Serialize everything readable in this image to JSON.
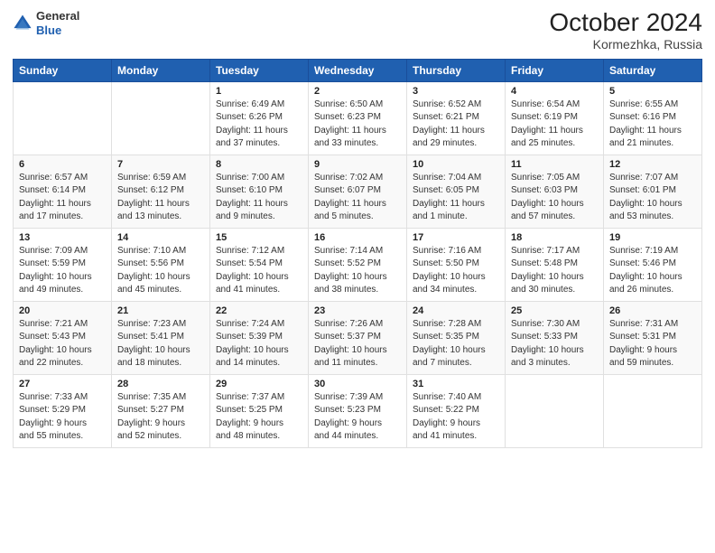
{
  "header": {
    "logo": {
      "general": "General",
      "blue": "Blue"
    },
    "title": "October 2024",
    "location": "Kormezhka, Russia"
  },
  "weekdays": [
    "Sunday",
    "Monday",
    "Tuesday",
    "Wednesday",
    "Thursday",
    "Friday",
    "Saturday"
  ],
  "weeks": [
    [
      {
        "day": "",
        "info": ""
      },
      {
        "day": "",
        "info": ""
      },
      {
        "day": "1",
        "info": "Sunrise: 6:49 AM\nSunset: 6:26 PM\nDaylight: 11 hours\nand 37 minutes."
      },
      {
        "day": "2",
        "info": "Sunrise: 6:50 AM\nSunset: 6:23 PM\nDaylight: 11 hours\nand 33 minutes."
      },
      {
        "day": "3",
        "info": "Sunrise: 6:52 AM\nSunset: 6:21 PM\nDaylight: 11 hours\nand 29 minutes."
      },
      {
        "day": "4",
        "info": "Sunrise: 6:54 AM\nSunset: 6:19 PM\nDaylight: 11 hours\nand 25 minutes."
      },
      {
        "day": "5",
        "info": "Sunrise: 6:55 AM\nSunset: 6:16 PM\nDaylight: 11 hours\nand 21 minutes."
      }
    ],
    [
      {
        "day": "6",
        "info": "Sunrise: 6:57 AM\nSunset: 6:14 PM\nDaylight: 11 hours\nand 17 minutes."
      },
      {
        "day": "7",
        "info": "Sunrise: 6:59 AM\nSunset: 6:12 PM\nDaylight: 11 hours\nand 13 minutes."
      },
      {
        "day": "8",
        "info": "Sunrise: 7:00 AM\nSunset: 6:10 PM\nDaylight: 11 hours\nand 9 minutes."
      },
      {
        "day": "9",
        "info": "Sunrise: 7:02 AM\nSunset: 6:07 PM\nDaylight: 11 hours\nand 5 minutes."
      },
      {
        "day": "10",
        "info": "Sunrise: 7:04 AM\nSunset: 6:05 PM\nDaylight: 11 hours\nand 1 minute."
      },
      {
        "day": "11",
        "info": "Sunrise: 7:05 AM\nSunset: 6:03 PM\nDaylight: 10 hours\nand 57 minutes."
      },
      {
        "day": "12",
        "info": "Sunrise: 7:07 AM\nSunset: 6:01 PM\nDaylight: 10 hours\nand 53 minutes."
      }
    ],
    [
      {
        "day": "13",
        "info": "Sunrise: 7:09 AM\nSunset: 5:59 PM\nDaylight: 10 hours\nand 49 minutes."
      },
      {
        "day": "14",
        "info": "Sunrise: 7:10 AM\nSunset: 5:56 PM\nDaylight: 10 hours\nand 45 minutes."
      },
      {
        "day": "15",
        "info": "Sunrise: 7:12 AM\nSunset: 5:54 PM\nDaylight: 10 hours\nand 41 minutes."
      },
      {
        "day": "16",
        "info": "Sunrise: 7:14 AM\nSunset: 5:52 PM\nDaylight: 10 hours\nand 38 minutes."
      },
      {
        "day": "17",
        "info": "Sunrise: 7:16 AM\nSunset: 5:50 PM\nDaylight: 10 hours\nand 34 minutes."
      },
      {
        "day": "18",
        "info": "Sunrise: 7:17 AM\nSunset: 5:48 PM\nDaylight: 10 hours\nand 30 minutes."
      },
      {
        "day": "19",
        "info": "Sunrise: 7:19 AM\nSunset: 5:46 PM\nDaylight: 10 hours\nand 26 minutes."
      }
    ],
    [
      {
        "day": "20",
        "info": "Sunrise: 7:21 AM\nSunset: 5:43 PM\nDaylight: 10 hours\nand 22 minutes."
      },
      {
        "day": "21",
        "info": "Sunrise: 7:23 AM\nSunset: 5:41 PM\nDaylight: 10 hours\nand 18 minutes."
      },
      {
        "day": "22",
        "info": "Sunrise: 7:24 AM\nSunset: 5:39 PM\nDaylight: 10 hours\nand 14 minutes."
      },
      {
        "day": "23",
        "info": "Sunrise: 7:26 AM\nSunset: 5:37 PM\nDaylight: 10 hours\nand 11 minutes."
      },
      {
        "day": "24",
        "info": "Sunrise: 7:28 AM\nSunset: 5:35 PM\nDaylight: 10 hours\nand 7 minutes."
      },
      {
        "day": "25",
        "info": "Sunrise: 7:30 AM\nSunset: 5:33 PM\nDaylight: 10 hours\nand 3 minutes."
      },
      {
        "day": "26",
        "info": "Sunrise: 7:31 AM\nSunset: 5:31 PM\nDaylight: 9 hours\nand 59 minutes."
      }
    ],
    [
      {
        "day": "27",
        "info": "Sunrise: 7:33 AM\nSunset: 5:29 PM\nDaylight: 9 hours\nand 55 minutes."
      },
      {
        "day": "28",
        "info": "Sunrise: 7:35 AM\nSunset: 5:27 PM\nDaylight: 9 hours\nand 52 minutes."
      },
      {
        "day": "29",
        "info": "Sunrise: 7:37 AM\nSunset: 5:25 PM\nDaylight: 9 hours\nand 48 minutes."
      },
      {
        "day": "30",
        "info": "Sunrise: 7:39 AM\nSunset: 5:23 PM\nDaylight: 9 hours\nand 44 minutes."
      },
      {
        "day": "31",
        "info": "Sunrise: 7:40 AM\nSunset: 5:22 PM\nDaylight: 9 hours\nand 41 minutes."
      },
      {
        "day": "",
        "info": ""
      },
      {
        "day": "",
        "info": ""
      }
    ]
  ]
}
